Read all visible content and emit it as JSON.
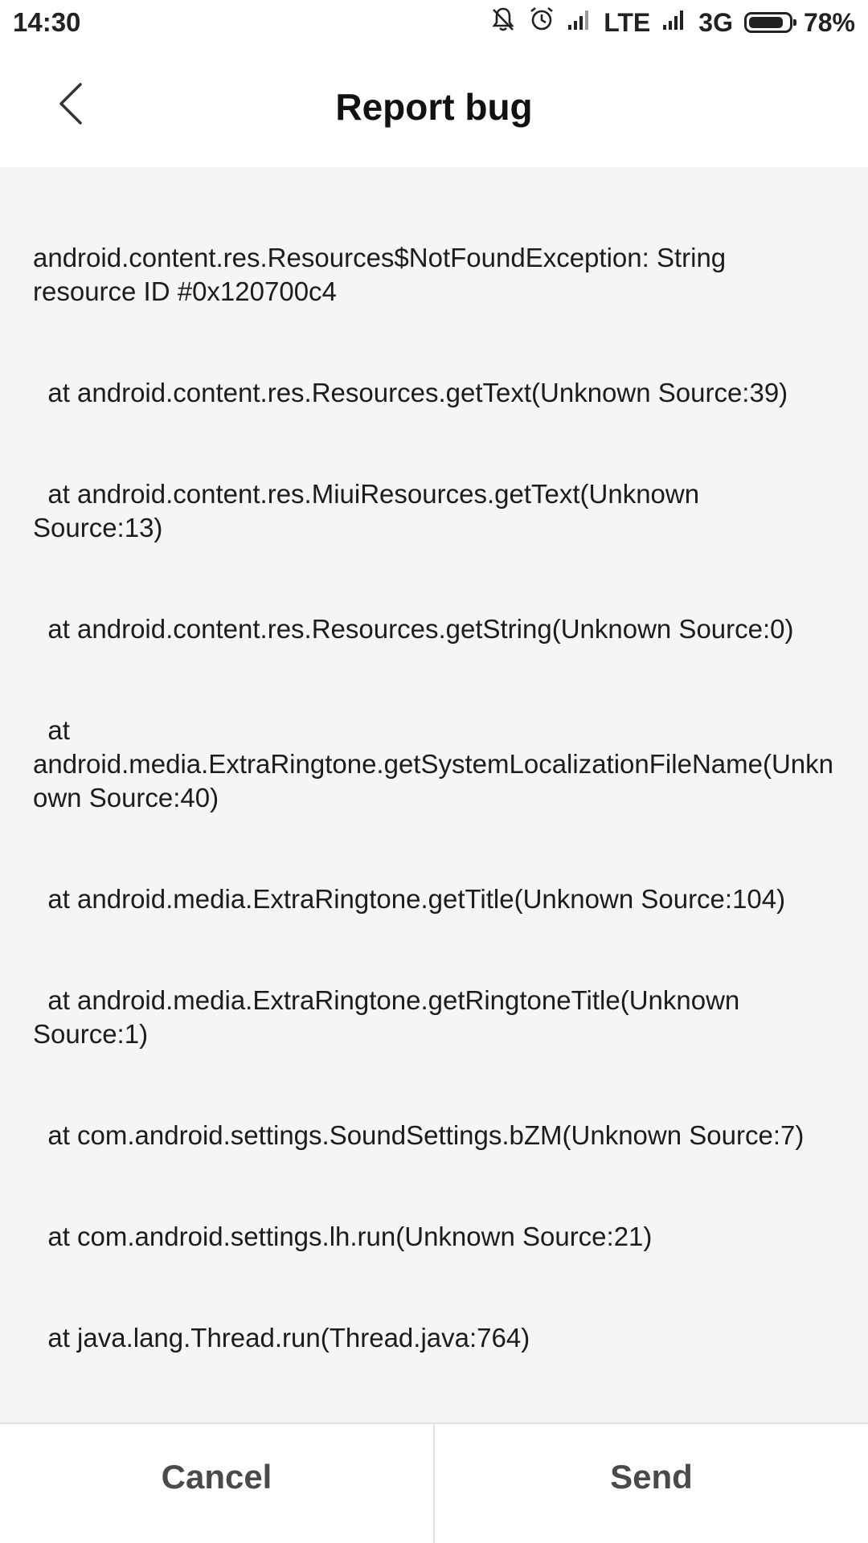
{
  "status_bar": {
    "time": "14:30",
    "network_1": "LTE",
    "network_2": "3G",
    "battery": "78%",
    "icons": [
      "bell-muted-icon",
      "alarm-icon",
      "signal-icon",
      "signal-icon",
      "battery-icon"
    ]
  },
  "header": {
    "title": "Report bug",
    "back_icon": "chevron-left-icon"
  },
  "content": {
    "lines": [
      "android.content.res.Resources$NotFoundException: String resource ID #0x120700c4",
      "  at android.content.res.Resources.getText(Unknown Source:39)",
      "  at android.content.res.MiuiResources.getText(Unknown Source:13)",
      "  at android.content.res.Resources.getString(Unknown Source:0)",
      "  at android.media.ExtraRingtone.getSystemLocalizationFileName(Unknown Source:40)",
      "  at android.media.ExtraRingtone.getTitle(Unknown Source:104)",
      "  at android.media.ExtraRingtone.getRingtoneTitle(Unknown Source:1)",
      "  at com.android.settings.SoundSettings.bZM(Unknown Source:7)",
      "  at com.android.settings.lh.run(Unknown Source:21)",
      "  at java.lang.Thread.run(Thread.java:764)"
    ]
  },
  "footer": {
    "cancel_label": "Cancel",
    "send_label": "Send"
  }
}
